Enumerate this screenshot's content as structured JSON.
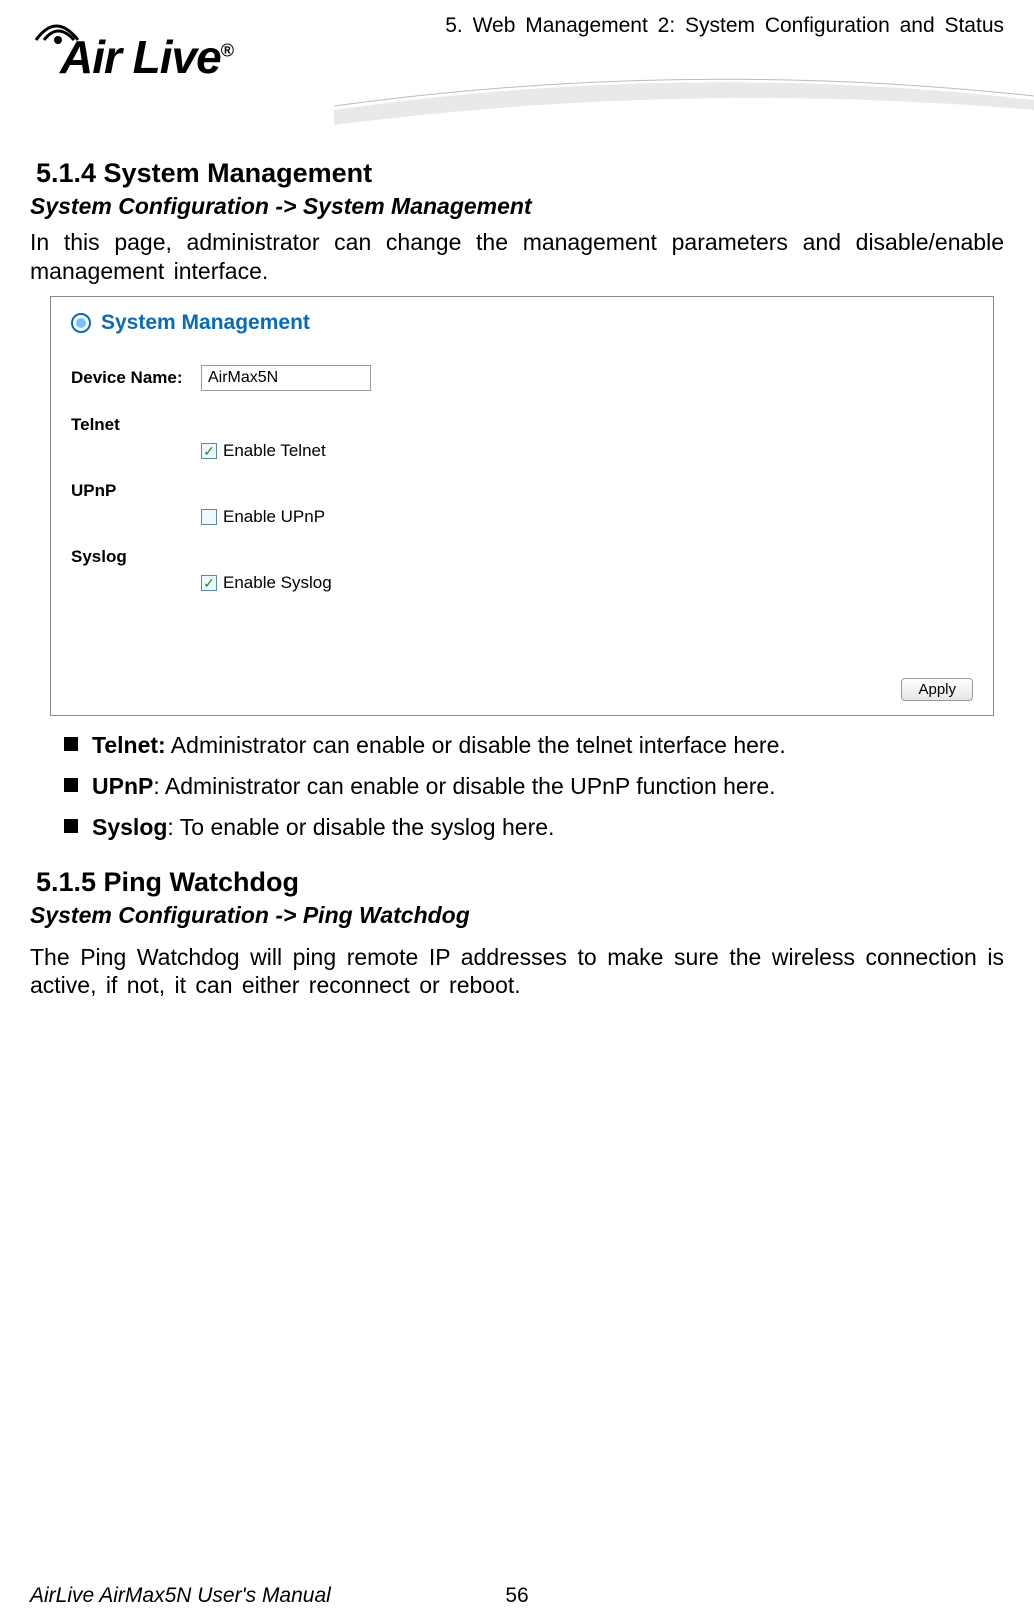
{
  "header": {
    "chapter": "5. Web Management 2: System Configuration and Status",
    "logo_text": "Air Live",
    "logo_reg": "®"
  },
  "section1": {
    "heading": "5.1.4 System Management",
    "breadcrumb": "System Configuration -> System Management",
    "intro": "In this page, administrator can change the management parameters and disable/enable management interface."
  },
  "panel": {
    "title": "System Management",
    "device_name_label": "Device Name:",
    "device_name_value": "AirMax5N",
    "telnet_label": "Telnet",
    "telnet_check_label": "Enable Telnet",
    "telnet_checked": true,
    "upnp_label": "UPnP",
    "upnp_check_label": "Enable UPnP",
    "upnp_checked": false,
    "syslog_label": "Syslog",
    "syslog_check_label": "Enable Syslog",
    "syslog_checked": true,
    "apply_label": "Apply"
  },
  "bullets": [
    {
      "bold": "Telnet:",
      "text": " Administrator can enable or disable the telnet interface here."
    },
    {
      "bold": "UPnP",
      "text": ": Administrator can enable or disable the UPnP function here."
    },
    {
      "bold": "Syslog",
      "text": ": To enable or disable the syslog here."
    }
  ],
  "section2": {
    "heading": "5.1.5  Ping Watchdog",
    "breadcrumb": "System Configuration -> Ping Watchdog",
    "intro": "The Ping Watchdog will ping remote IP addresses to make sure the wireless connection is active, if not, it can either reconnect or reboot."
  },
  "footer": {
    "page_num": "56",
    "manual": "AirLive AirMax5N User's Manual"
  }
}
